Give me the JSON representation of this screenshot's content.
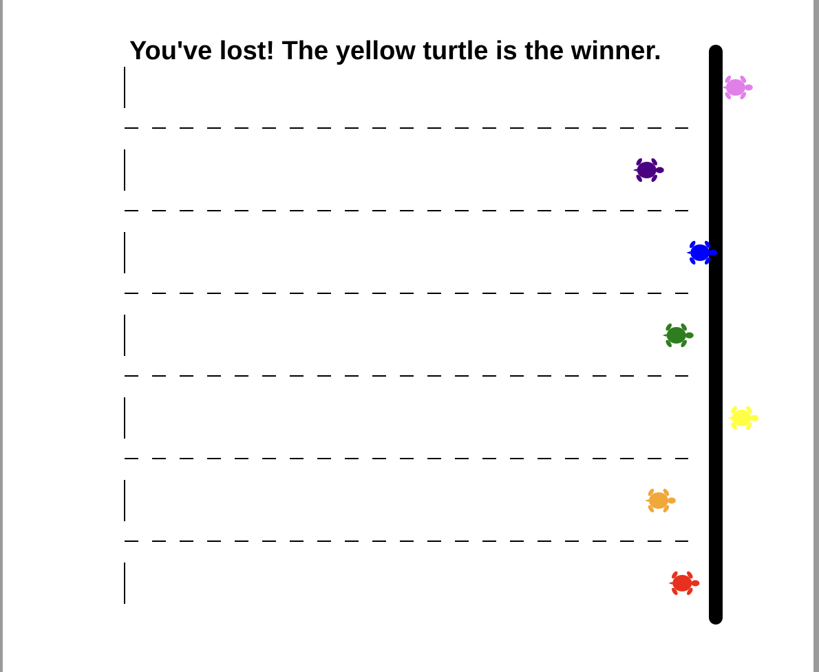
{
  "message": "You've lost! The yellow turtle is the winner.",
  "winner": "yellow",
  "lane_count": 7,
  "finish_line_color": "#000000",
  "turtles": [
    {
      "name": "violet",
      "color": "#e081e8",
      "progress": 1.03
    },
    {
      "name": "indigo",
      "color": "#4b0082",
      "progress": 0.88
    },
    {
      "name": "blue",
      "color": "#0000ff",
      "progress": 0.97
    },
    {
      "name": "green",
      "color": "#2e7d1e",
      "progress": 0.93
    },
    {
      "name": "yellow",
      "color": "#ffff44",
      "progress": 1.04
    },
    {
      "name": "orange",
      "color": "#f0a83a",
      "progress": 0.9
    },
    {
      "name": "red",
      "color": "#e8301e",
      "progress": 0.94
    }
  ]
}
